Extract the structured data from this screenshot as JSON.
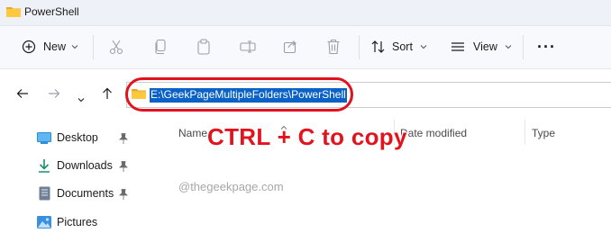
{
  "window": {
    "title": "PowerShell"
  },
  "commandbar": {
    "new_label": "New",
    "sort_label": "Sort",
    "view_label": "View",
    "more_label": "···"
  },
  "address": {
    "path": "E:\\GeekPageMultipleFolders\\PowerShell"
  },
  "annotation": {
    "text": "CTRL + C to copy"
  },
  "navigation": {
    "items": [
      {
        "label": "Desktop"
      },
      {
        "label": "Downloads"
      },
      {
        "label": "Documents"
      },
      {
        "label": "Pictures"
      }
    ]
  },
  "columns": {
    "name": "Name",
    "date_modified": "Date modified",
    "type": "Type"
  },
  "watermark": "@thegeekpage.com"
}
